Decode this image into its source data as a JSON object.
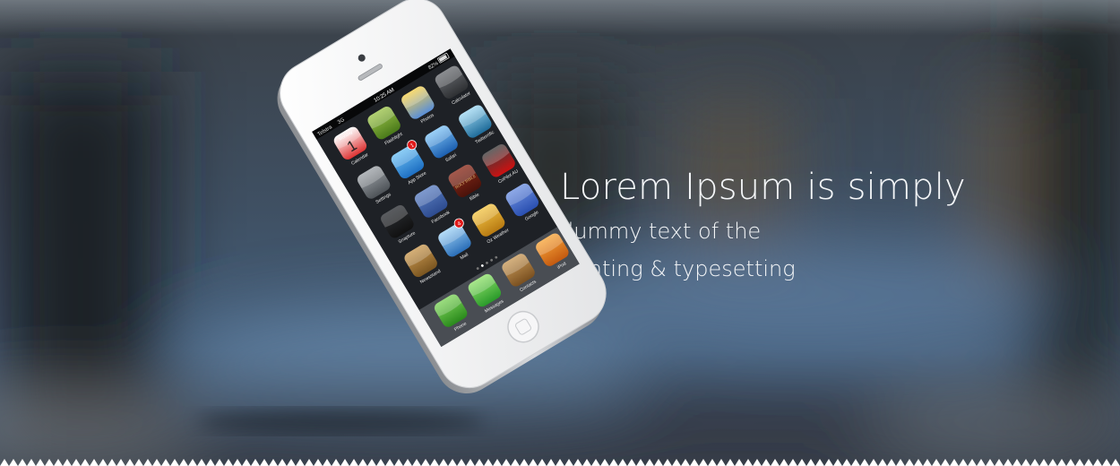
{
  "hero": {
    "headline_line1": "Lorem Ipsum is simply",
    "headline_line2": "dummy text of the",
    "headline_line3": "printing & typesetting"
  },
  "colors": {
    "text": "#f4f6f8",
    "background_dark": "#1e2126",
    "background_blue": "#4d6a8a",
    "phone_body": "#f2f2f2",
    "screen_bg": "#1a1d22",
    "footer_white": "#ffffff"
  },
  "phone": {
    "status": {
      "carrier": "Telstra",
      "network": "3G",
      "time": "10:25 AM",
      "battery": "82%"
    },
    "apps": [
      {
        "label": "Calendar",
        "icon": "calendar-icon",
        "date": "1",
        "day": "Monday"
      },
      {
        "label": "Flashlight",
        "icon": "flashlight-icon"
      },
      {
        "label": "Photos",
        "icon": "photos-icon"
      },
      {
        "label": "Calculator",
        "icon": "calculator-icon"
      },
      {
        "label": "Settings",
        "icon": "settings-icon"
      },
      {
        "label": "App Store",
        "icon": "app-store-icon",
        "badge": "1"
      },
      {
        "label": "Safari",
        "icon": "safari-icon"
      },
      {
        "label": "Twitterrific",
        "icon": "twitter-icon"
      },
      {
        "label": "Snapture",
        "icon": "camera-icon"
      },
      {
        "label": "Facebook",
        "icon": "facebook-icon"
      },
      {
        "label": "Bible",
        "icon": "bible-icon",
        "icon_text": "HOLY BIBLE"
      },
      {
        "label": "CoPilot AU",
        "icon": "copilot-icon"
      },
      {
        "label": "Newsstand",
        "icon": "newsstand-icon"
      },
      {
        "label": "Mail",
        "icon": "mail-icon",
        "badge": "4"
      },
      {
        "label": "Oz Weather",
        "icon": "weather-icon"
      },
      {
        "label": "Google",
        "icon": "google-icon"
      }
    ],
    "dock": [
      {
        "label": "Phone",
        "icon": "phone-icon"
      },
      {
        "label": "Messages",
        "icon": "messages-icon"
      },
      {
        "label": "Contacts",
        "icon": "contacts-icon"
      },
      {
        "label": "iPod",
        "icon": "ipod-icon"
      }
    ]
  }
}
